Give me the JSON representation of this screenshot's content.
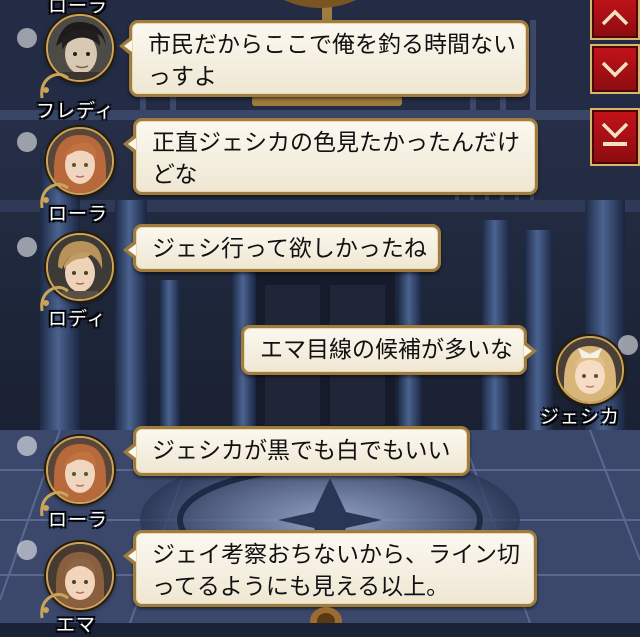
{
  "colors": {
    "bubble_fill": "#fbf8ef",
    "bubble_border": "#a07c3f",
    "name_text": "#ffffff",
    "scroll_button": "#b4141a",
    "scroll_button_border": "#d7b66b"
  },
  "scroll_controls": {
    "items": [
      {
        "icon": "chevron-up-icon"
      },
      {
        "icon": "chevron-down-icon"
      },
      {
        "icon": "double-chevron-down-icon"
      }
    ]
  },
  "chat": {
    "top_name": "ローラ",
    "messages": [
      {
        "speaker": "フレディ",
        "side": "left",
        "lines": [
          "市民だからここで俺を釣る時間ない",
          "っすよ"
        ]
      },
      {
        "speaker": "ローラ",
        "side": "left",
        "lines": [
          "正直ジェシカの色見たかったんだけ",
          "どな"
        ]
      },
      {
        "speaker": "ロディ",
        "side": "left",
        "lines": [
          "ジェシ行って欲しかったね"
        ]
      },
      {
        "speaker": "ジェシカ",
        "side": "right",
        "lines": [
          "エマ目線の候補が多いな"
        ]
      },
      {
        "speaker": "ローラ",
        "side": "left",
        "lines": [
          "ジェシカが黒でも白でもいい"
        ]
      },
      {
        "speaker": "エマ",
        "side": "left",
        "lines": [
          "ジェイ考察おちないから、ライン切",
          "ってるようにも見える以上。"
        ]
      }
    ]
  }
}
